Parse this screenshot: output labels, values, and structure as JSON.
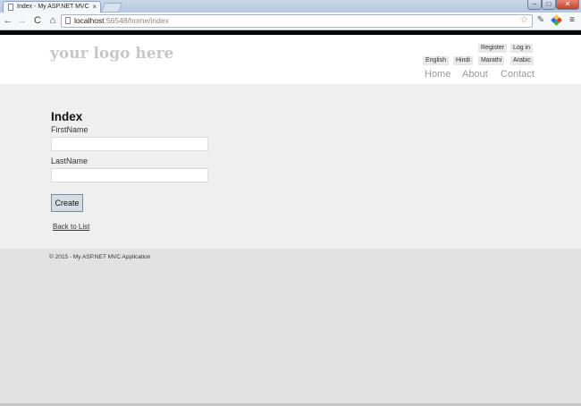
{
  "browser": {
    "tab_title": "Index - My ASP.NET MVC",
    "tab_close": "×",
    "url_host": "localhost",
    "url_path": ":56548/home/index",
    "controls": {
      "minimize": "–",
      "maximize": "□",
      "close": "✕"
    },
    "icons": {
      "back": "←",
      "forward": "→",
      "reload": "C",
      "home": "⌂",
      "star": "☆",
      "wrench": "✎",
      "menu": "≡"
    }
  },
  "header": {
    "logo": "your logo here",
    "account": {
      "register": "Register",
      "login": "Log in"
    },
    "languages": [
      "English",
      "Hindi",
      "Marathi",
      "Arabic"
    ],
    "nav": [
      "Home",
      "About",
      "Contact"
    ]
  },
  "main": {
    "title": "Index",
    "fields": [
      {
        "label": "FirstName",
        "value": ""
      },
      {
        "label": "LastName",
        "value": ""
      }
    ],
    "create_label": "Create",
    "back_link": "Back to List"
  },
  "footer": {
    "text": "© 2015 - My ASP.NET MVC Application"
  }
}
